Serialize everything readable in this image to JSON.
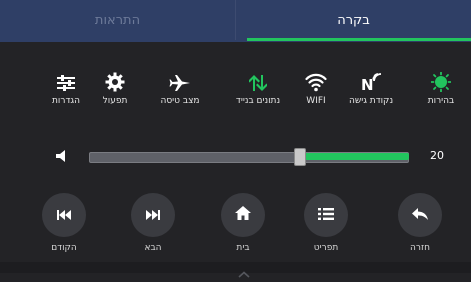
{
  "tabs": {
    "notifications_label": "התראות",
    "control_label": "בקרה",
    "active": "control"
  },
  "toggles": [
    {
      "id": "brightness",
      "label": "בהירות",
      "icon": "sun-icon",
      "active": true
    },
    {
      "id": "access-point",
      "label": "נקודת גישה",
      "icon": "hotspot-icon",
      "active": false
    },
    {
      "id": "wifi",
      "label": "WIFI",
      "icon": "wifi-icon",
      "active": false
    },
    {
      "id": "mobile-data",
      "label": "נתונים בנייד",
      "icon": "data-arrows-icon",
      "active": true
    },
    {
      "id": "airplane",
      "label": "מצב טיסה",
      "icon": "airplane-icon",
      "active": false
    },
    {
      "id": "operation",
      "label": "תפעול",
      "icon": "gear-icon",
      "active": false
    },
    {
      "id": "settings",
      "label": "הגדרות",
      "icon": "sliders-icon",
      "active": false
    }
  ],
  "volume": {
    "value": "20",
    "level_fraction": 0.34,
    "icon": "speaker-icon"
  },
  "nav_buttons": [
    {
      "id": "back",
      "label": "חזרה",
      "icon": "back-arrow-icon"
    },
    {
      "id": "menu",
      "label": "תפריט",
      "icon": "menu-list-icon"
    },
    {
      "id": "home",
      "label": "בית",
      "icon": "home-icon"
    },
    {
      "id": "next",
      "label": "הבא",
      "icon": "next-track-icon"
    },
    {
      "id": "previous",
      "label": "הקודם",
      "icon": "previous-track-icon"
    }
  ],
  "colors": {
    "accent": "#22c55e",
    "tab_bar": "#2f3f66",
    "background": "#232326",
    "button_circle": "#3a3b40"
  }
}
